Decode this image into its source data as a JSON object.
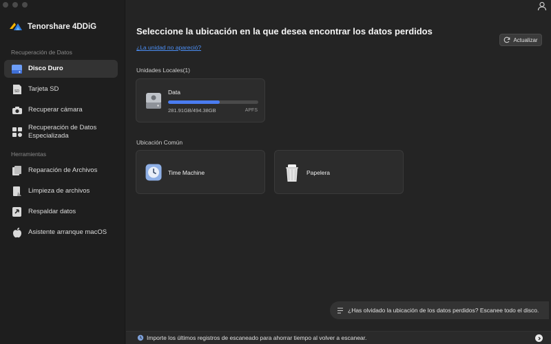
{
  "app": {
    "brand": "Tenorshare 4DDiG"
  },
  "sidebar": {
    "sections": [
      {
        "title": "Recuperación de Datos"
      },
      {
        "title": "Herramientas"
      }
    ],
    "items": [
      {
        "label": "Disco Duro",
        "icon": "hard-drive-icon"
      },
      {
        "label": "Tarjeta SD",
        "icon": "sd-card-icon"
      },
      {
        "label": "Recuperar cámara",
        "icon": "camera-icon"
      },
      {
        "label": "Recuperación de Datos Especializada",
        "icon": "specialized-recovery-icon"
      },
      {
        "label": "Reparación de Archivos",
        "icon": "file-repair-icon"
      },
      {
        "label": "Limpieza de archivos",
        "icon": "file-cleanup-icon"
      },
      {
        "label": "Respaldar datos",
        "icon": "backup-icon"
      },
      {
        "label": "Asistente arranque macOS",
        "icon": "apple-icon"
      }
    ]
  },
  "main": {
    "title": "Seleccione la ubicación en la que desea encontrar los datos perdidos",
    "missing_link": "¿La unidad no apareció?",
    "refresh_label": "Actualizar",
    "local_units_label": "Unidades Locales(1)",
    "drive": {
      "name": "Data",
      "size": "281.91GB/494.38GB",
      "fs": "APFS",
      "used_fraction": 0.57
    },
    "common_label": "Ubicación Común",
    "common": [
      {
        "name": "Time Machine",
        "icon": "time-machine-icon"
      },
      {
        "name": "Papelera",
        "icon": "trash-icon"
      }
    ],
    "scan_prompt": "¿Has olvidado la ubicación de los datos perdidos? Escanee todo el disco.",
    "bottom_text": "Importe los últimos registros de escaneado para ahorrar tiempo al volver a escanear."
  },
  "colors": {
    "accent": "#4a7cf0",
    "link": "#4b8ef5",
    "background": "#242424",
    "sidebar": "#1e1e1e"
  }
}
